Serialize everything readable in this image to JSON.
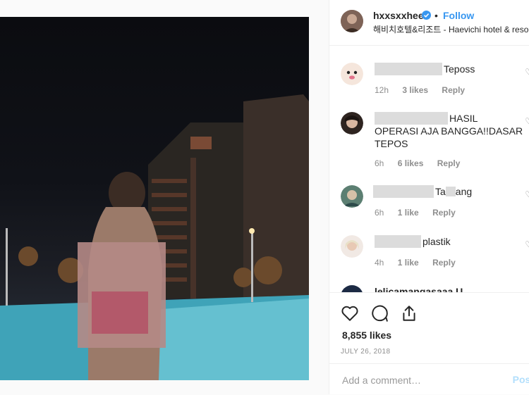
{
  "post": {
    "username": "hxxsxxhee",
    "verified": true,
    "follow_label": "Follow",
    "separator": "•",
    "location": "해비치호텔&리조트 - Haevichi hotel & resort"
  },
  "comments": [
    {
      "name_redacted": true,
      "text": "Teposs",
      "time": "12h",
      "likes": "3 likes",
      "reply": "Reply"
    },
    {
      "name_redacted": true,
      "text_line1": "HASIL",
      "text_line2": "OPERASI AJA BANGGA!!DASAR",
      "text_line3": "TEPOS",
      "time": "6h",
      "likes": "6 likes",
      "reply": "Reply"
    },
    {
      "name_redacted": true,
      "text_a": "Ta",
      "text_b": "ang",
      "time": "6h",
      "likes": "1 like",
      "reply": "Reply"
    },
    {
      "name_redacted": true,
      "text": "plastik",
      "time": "4h",
      "likes": "1 like",
      "reply": "Reply"
    },
    {
      "partial": "lelicamangasaaa U"
    }
  ],
  "actions": {
    "likes": "8,855 likes",
    "date": "JULY 26, 2018"
  },
  "add_comment": {
    "placeholder": "Add a comment…",
    "post_label": "Post"
  },
  "colors": {
    "accent": "#3897f0",
    "verified": "#3897f0"
  }
}
